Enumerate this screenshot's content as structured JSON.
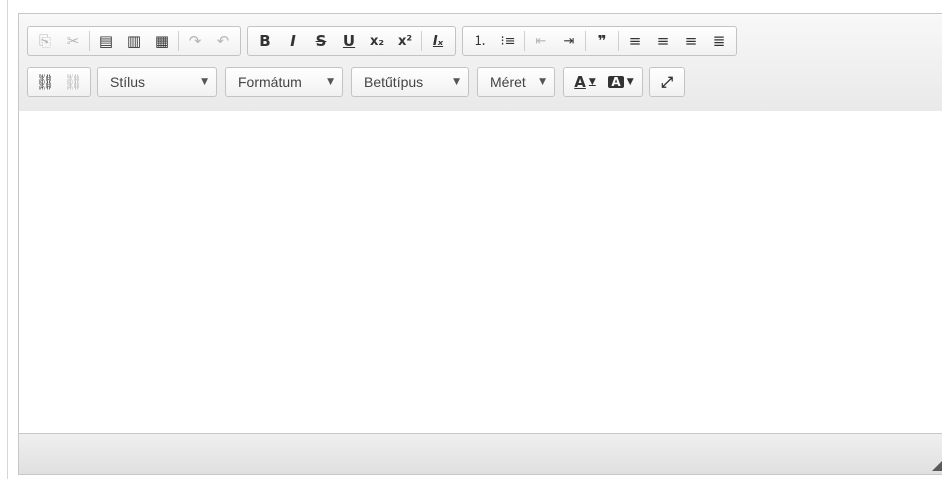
{
  "toolbar": {
    "row1": {
      "clipboard": [
        {
          "name": "copy-icon",
          "glyph": "⎘",
          "dim": true
        },
        {
          "name": "cut-icon",
          "glyph": "✂",
          "dim": true
        },
        {
          "name": "paste-icon",
          "glyph": "📋",
          "dim": false
        },
        {
          "name": "paste-from-word-icon",
          "glyph": "🗐",
          "dim": false
        },
        {
          "name": "paste-as-text-icon",
          "glyph": "🗒",
          "dim": false
        },
        {
          "name": "redo-icon",
          "glyph": "↷",
          "dim": true
        },
        {
          "name": "undo-icon",
          "glyph": "↶",
          "dim": true
        }
      ],
      "format": [
        {
          "name": "bold-icon",
          "glyph": "B",
          "cls": "b"
        },
        {
          "name": "italic-icon",
          "glyph": "I",
          "cls": "b i"
        },
        {
          "name": "strikethrough-icon",
          "glyph": "S",
          "cls": "b s"
        },
        {
          "name": "underline-icon",
          "glyph": "U",
          "cls": "b u"
        },
        {
          "name": "subscript-icon",
          "glyph": "x₂",
          "cls": "b small"
        },
        {
          "name": "superscript-icon",
          "glyph": "x²",
          "cls": "b small"
        },
        {
          "name": "remove-format-icon",
          "glyph": "Ix",
          "cls": "b i u small"
        }
      ],
      "paragraph": [
        {
          "name": "numbered-list-icon",
          "glyph": "⒈"
        },
        {
          "name": "bulleted-list-icon",
          "glyph": "☰"
        },
        {
          "name": "outdent-icon",
          "glyph": "⇤",
          "dim": true
        },
        {
          "name": "indent-icon",
          "glyph": "⇥"
        },
        {
          "name": "blockquote-icon",
          "glyph": "❞"
        },
        {
          "name": "align-left-icon",
          "glyph": "≡"
        },
        {
          "name": "align-center-icon",
          "glyph": "≡"
        },
        {
          "name": "align-right-icon",
          "glyph": "≡"
        },
        {
          "name": "justify-icon",
          "glyph": "≣"
        }
      ]
    },
    "row2": {
      "links": [
        {
          "name": "link-icon",
          "glyph": "🔗"
        },
        {
          "name": "unlink-icon",
          "glyph": "⛓",
          "dim": true
        }
      ],
      "combos": [
        {
          "name": "style-dropdown",
          "label": "Stílus",
          "width": 120
        },
        {
          "name": "format-dropdown",
          "label": "Formátum",
          "width": 118
        },
        {
          "name": "font-dropdown",
          "label": "Betűtípus",
          "width": 118
        },
        {
          "name": "size-dropdown",
          "label": "Méret",
          "width": 78
        }
      ],
      "colors": [
        {
          "name": "text-color-icon",
          "glyph": "A▾"
        },
        {
          "name": "background-color-icon",
          "glyph": "🅰▾"
        }
      ],
      "maximize": {
        "name": "maximize-icon",
        "glyph": "⛶"
      }
    }
  }
}
